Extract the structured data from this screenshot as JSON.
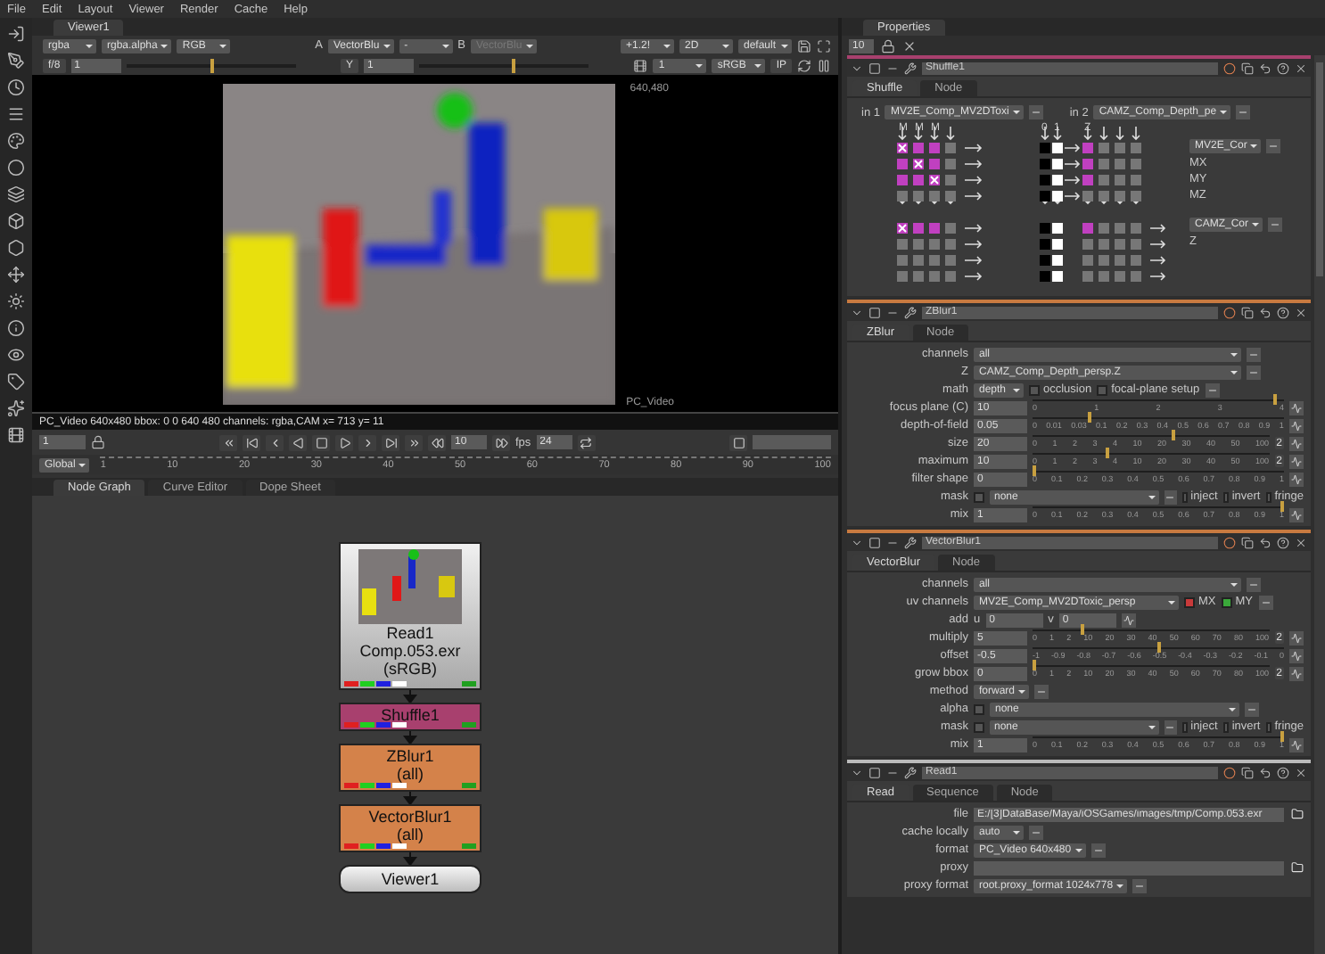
{
  "menubar": [
    "File",
    "Edit",
    "Layout",
    "Viewer",
    "Render",
    "Cache",
    "Help"
  ],
  "viewer": {
    "tab": {
      "label": "Viewer1",
      "selected": true
    },
    "toolbar_1": [
      [
        {
          "kind": "menu",
          "value": "rgba"
        },
        {
          "kind": "menu",
          "value": "rgba.alpha"
        },
        {
          "kind": "menu",
          "value": "RGB"
        }
      ],
      [
        {
          "kind": "label",
          "text": "A"
        },
        {
          "kind": "menu",
          "value": "VectorBlu"
        },
        {
          "kind": "menu",
          "value": "-"
        },
        {
          "kind": "label",
          "text": "B"
        },
        {
          "kind": "menu",
          "value": "VectorBlu",
          "disabled": true
        }
      ],
      [
        {
          "kind": "menu",
          "value": "+1.2!"
        },
        {
          "kind": "menu",
          "value": "2D"
        },
        {
          "kind": "menu",
          "value": "default"
        }
      ]
    ],
    "toolbar_2": [
      [
        {
          "kind": "button",
          "text": "f/8"
        },
        {
          "kind": "field",
          "value": "1"
        },
        {
          "kind": "track",
          "level": 0.5
        }
      ],
      [
        {
          "kind": "button",
          "text": "Y"
        },
        {
          "kind": "field",
          "value": "1"
        },
        {
          "kind": "track",
          "level": 0.55
        }
      ],
      [
        {
          "kind": "menu",
          "value": "1"
        },
        {
          "kind": "menu",
          "value": "sRGB"
        },
        {
          "kind": "button",
          "text": "IP"
        }
      ]
    ],
    "format_corner": "640,480",
    "format_name": "PC_Video",
    "info": "PC_Video 640x480 bbox: 0 0 640 480 channels: rgba,CAM  x= 713 y=  11",
    "playback": {
      "frame": "1",
      "increment": "10",
      "fps_label": "fps",
      "fps": "24"
    },
    "timeline": {
      "range": "Global",
      "ticks": [
        "1",
        "10",
        "20",
        "30",
        "40",
        "50",
        "60",
        "70",
        "80",
        "90",
        "100"
      ]
    }
  },
  "node_graph": {
    "tabs": [
      {
        "label": "Node Graph",
        "selected": true
      },
      {
        "label": "Curve Editor",
        "selected": false
      },
      {
        "label": "Dope Sheet",
        "selected": false
      }
    ],
    "nodes": [
      {
        "kind": "read",
        "name": "Read1",
        "file": "Comp.053.exr",
        "colorspace": "(sRGB)"
      },
      {
        "kind": "shuffle",
        "name": "Shuffle1"
      },
      {
        "kind": "filter",
        "name": "ZBlur1",
        "sub": "(all)"
      },
      {
        "kind": "filter",
        "name": "VectorBlur1",
        "sub": "(all)"
      },
      {
        "kind": "viewer",
        "name": "Viewer1"
      }
    ]
  },
  "properties": {
    "tab": {
      "label": "Properties",
      "selected": true
    },
    "max_panels": "10",
    "panels": [
      {
        "kind": "shuffle",
        "name": "Shuffle1",
        "tabs": [
          {
            "label": "Shuffle",
            "selected": true
          },
          {
            "label": "Node",
            "selected": false
          }
        ],
        "shuffle": {
          "in1": {
            "label": "in 1",
            "value": "MV2E_Comp_MV2DToxi"
          },
          "in2": {
            "label": "in 2",
            "value": "CAMZ_Comp_Depth_pe"
          },
          "in1_columns": [
            "M",
            "M",
            "M"
          ],
          "in2_columns": [
            "0",
            "1",
            "Z"
          ],
          "outputs": [
            {
              "value": "MV2E_Cor",
              "channels": [
                "MX",
                "MY",
                "MZ"
              ]
            },
            {
              "value": "CAMZ_Cor",
              "channels": [
                "Z"
              ]
            }
          ]
        }
      },
      {
        "kind": "knobs",
        "name": "ZBlur1",
        "tabs": [
          {
            "label": "ZBlur",
            "selected": true
          },
          {
            "label": "Node",
            "selected": false
          }
        ],
        "rows": [
          {
            "kind": "wide_menu",
            "label": "channels",
            "value": "all"
          },
          {
            "kind": "wide_menu",
            "label": "Z",
            "value": "CAMZ_Comp_Depth_persp.Z"
          },
          {
            "kind": "menu",
            "label": "math",
            "value": "depth",
            "checks": [
              {
                "label": "occlusion",
                "checked": false
              },
              {
                "label": "focal-plane setup",
                "checked": false
              }
            ]
          },
          {
            "kind": "slider",
            "label": "focus plane (C)",
            "value": "10",
            "level": 0.97,
            "ticks": [
              "0",
              "1",
              "2",
              "3",
              "4"
            ]
          },
          {
            "kind": "slider",
            "label": "depth-of-field",
            "value": "0.05",
            "level": 0.22,
            "ticks": [
              "0",
              "0.01",
              "0.03",
              "0.1",
              "0.2",
              "0.3",
              "0.4",
              "0.5",
              "0.6",
              "0.7",
              "0.8",
              "0.9",
              "1"
            ]
          },
          {
            "kind": "slider",
            "label": "size",
            "value": "20",
            "level": 0.6,
            "extra": "2",
            "ticks": [
              "0",
              "1",
              "2",
              "3",
              "4",
              "10",
              "20",
              "30",
              "40",
              "50",
              "100"
            ]
          },
          {
            "kind": "slider",
            "label": "maximum",
            "value": "10",
            "level": 0.31,
            "extra": "2",
            "ticks": [
              "0",
              "1",
              "2",
              "3",
              "4",
              "10",
              "20",
              "30",
              "40",
              "50",
              "100"
            ]
          },
          {
            "kind": "slider",
            "label": "filter shape",
            "value": "0",
            "level": 0,
            "ticks": [
              "0",
              "0.1",
              "0.2",
              "0.3",
              "0.4",
              "0.5",
              "0.6",
              "0.7",
              "0.8",
              "0.9",
              "1"
            ]
          },
          {
            "kind": "mask",
            "label": "mask",
            "checked": false,
            "value": "none",
            "checks": [
              {
                "label": "inject",
                "checked": false
              },
              {
                "label": "invert",
                "checked": false
              },
              {
                "label": "fringe",
                "checked": false
              }
            ]
          },
          {
            "kind": "slider",
            "label": "mix",
            "value": "1",
            "level": 1,
            "ticks": [
              "0",
              "0.1",
              "0.2",
              "0.3",
              "0.4",
              "0.5",
              "0.6",
              "0.7",
              "0.8",
              "0.9",
              "1"
            ]
          }
        ]
      },
      {
        "kind": "knobs",
        "name": "VectorBlur1",
        "tabs": [
          {
            "label": "VectorBlur",
            "selected": true
          },
          {
            "label": "Node",
            "selected": false
          }
        ],
        "rows": [
          {
            "kind": "wide_menu",
            "label": "channels",
            "value": "all"
          },
          {
            "kind": "menu",
            "label": "uv channels",
            "value": "MV2E_Comp_MV2DToxic_persp",
            "checks": [
              {
                "label": "MX",
                "checked": true,
                "color": "#c83a3a"
              },
              {
                "label": "MY",
                "checked": true,
                "color": "#3aa83a"
              }
            ]
          },
          {
            "kind": "uv",
            "label": "add",
            "u_label": "u",
            "u": "0",
            "v_label": "v",
            "v": "0"
          },
          {
            "kind": "slider",
            "label": "multiply",
            "value": "5",
            "level": 0.21,
            "extra": "2",
            "ticks": [
              "0",
              "1",
              "2",
              "10",
              "20",
              "30",
              "40",
              "50",
              "60",
              "70",
              "80",
              "100"
            ]
          },
          {
            "kind": "slider",
            "label": "offset",
            "value": "-0.5",
            "level": 0.5,
            "ticks": [
              "-1",
              "-0.9",
              "-0.8",
              "-0.7",
              "-0.6",
              "-0.5",
              "-0.4",
              "-0.3",
              "-0.2",
              "-0.1",
              "0"
            ]
          },
          {
            "kind": "slider",
            "label": "grow bbox",
            "value": "0",
            "level": 0,
            "extra": "2",
            "ticks": [
              "0",
              "1",
              "2",
              "10",
              "20",
              "30",
              "40",
              "50",
              "60",
              "70",
              "80",
              "100"
            ]
          },
          {
            "kind": "menu",
            "label": "method",
            "value": "forward"
          },
          {
            "kind": "mask",
            "label": "alpha",
            "checked": false,
            "value": "none"
          },
          {
            "kind": "mask",
            "label": "mask",
            "checked": false,
            "value": "none",
            "checks": [
              {
                "label": "inject",
                "checked": false
              },
              {
                "label": "invert",
                "checked": false
              },
              {
                "label": "fringe",
                "checked": false
              }
            ]
          },
          {
            "kind": "slider",
            "label": "mix",
            "value": "1",
            "level": 1,
            "ticks": [
              "0",
              "0.1",
              "0.2",
              "0.3",
              "0.4",
              "0.5",
              "0.6",
              "0.7",
              "0.8",
              "0.9",
              "1"
            ]
          }
        ]
      },
      {
        "kind": "knobs",
        "name": "Read1",
        "tabs": [
          {
            "label": "Read",
            "selected": true
          },
          {
            "label": "Sequence",
            "selected": false
          },
          {
            "label": "Node",
            "selected": false
          }
        ],
        "rows": [
          {
            "kind": "file",
            "label": "file",
            "value": "E:/[3]DataBase/Maya/iOSGames/images/tmp/Comp.053.exr"
          },
          {
            "kind": "menu",
            "label": "cache locally",
            "value": "auto"
          },
          {
            "kind": "menu",
            "label": "format",
            "value": "PC_Video 640x480"
          },
          {
            "kind": "file",
            "label": "proxy"
          },
          {
            "kind": "menu",
            "label": "proxy format",
            "value": "root.proxy_format 1024x778"
          }
        ]
      }
    ]
  }
}
